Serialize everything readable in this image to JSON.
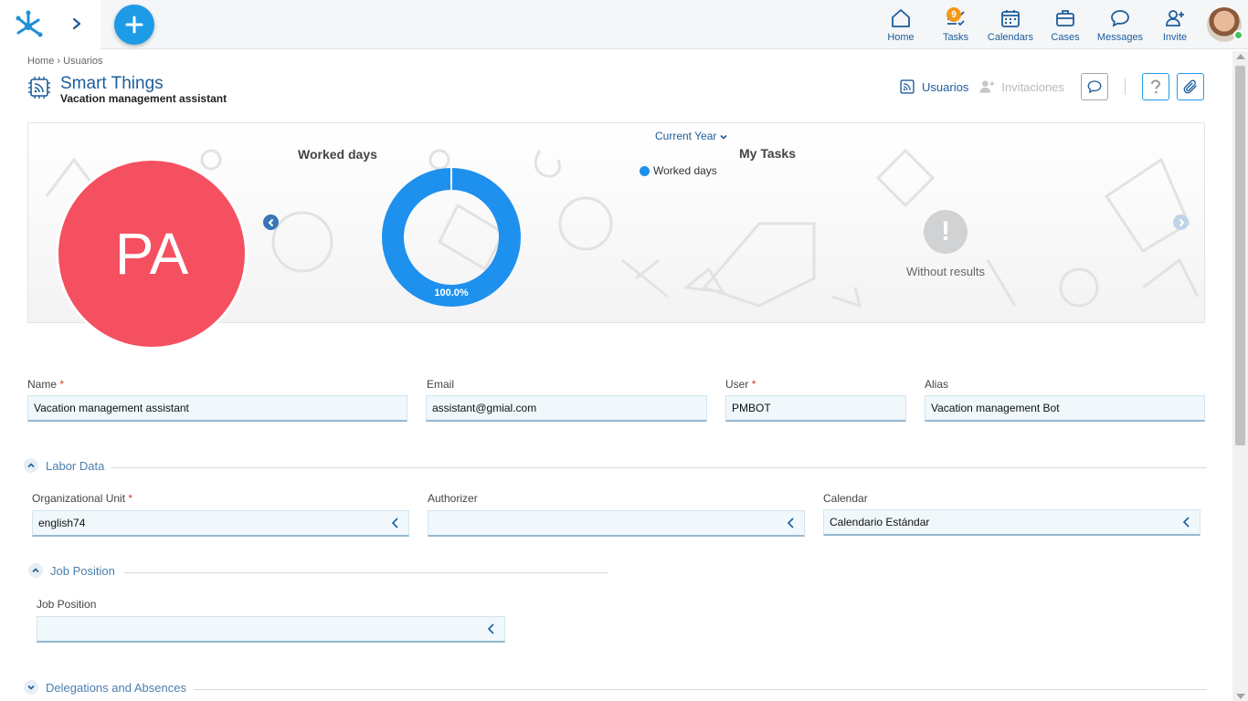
{
  "nav": {
    "items": [
      {
        "label": "Home",
        "icon": "home-icon"
      },
      {
        "label": "Tasks",
        "icon": "tasks-icon",
        "badge": "9"
      },
      {
        "label": "Calendars",
        "icon": "calendar-icon"
      },
      {
        "label": "Cases",
        "icon": "briefcase-icon"
      },
      {
        "label": "Messages",
        "icon": "message-icon"
      },
      {
        "label": "Invite",
        "icon": "invite-user-icon"
      }
    ]
  },
  "breadcrumb": "Home › Usuarios",
  "header": {
    "title": "Smart Things",
    "subtitle": "Vacation management assistant",
    "usuarios_link": "Usuarios",
    "invitaciones_link": "Invitaciones"
  },
  "banner": {
    "avatar_initials": "PA",
    "worked_days_title": "Worked days",
    "period_select": "Current Year",
    "legend_label": "Worked days",
    "donut_label": "100.0%",
    "my_tasks_title": "My Tasks",
    "no_results": "Without results"
  },
  "chart_data": {
    "type": "pie",
    "title": "Worked days",
    "categories": [
      "Worked days"
    ],
    "values": [
      100.0
    ],
    "colors": [
      "#1e90ee"
    ],
    "legend": "top-right"
  },
  "form": {
    "name_label": "Name",
    "name_value": "Vacation management assistant",
    "email_label": "Email",
    "email_value": "assistant@gmial.com",
    "user_label": "User",
    "user_value": "PMBOT",
    "alias_label": "Alias",
    "alias_value": "Vacation management Bot"
  },
  "labor": {
    "section_title": "Labor Data",
    "org_unit_label": "Organizational Unit",
    "org_unit_value": "english74",
    "authorizer_label": "Authorizer",
    "authorizer_value": "",
    "calendar_label": "Calendar",
    "calendar_value": "Calendario Estándar"
  },
  "job": {
    "section_title": "Job Position",
    "field_label": "Job Position",
    "field_value": ""
  },
  "delegations": {
    "section_title": "Delegations and Absences"
  },
  "colors": {
    "primary": "#1c5d9c",
    "accent": "#1e9be7",
    "avatar_bg": "#f5505f",
    "badge": "#f39a1b"
  }
}
